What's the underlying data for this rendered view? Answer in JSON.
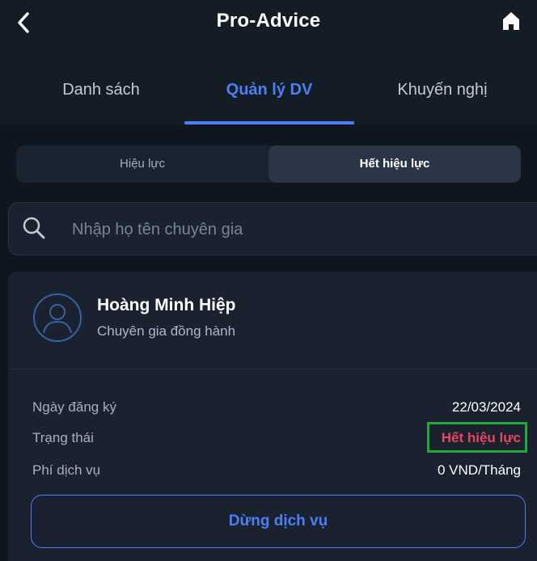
{
  "header": {
    "title": "Pro-Advice",
    "back_icon": "chevron-left-icon",
    "home_icon": "home-icon"
  },
  "tabs": [
    {
      "label": "Danh sách",
      "active": false
    },
    {
      "label": "Quản lý DV",
      "active": true
    },
    {
      "label": "Khuyến nghị",
      "active": false
    }
  ],
  "segments": [
    {
      "label": "Hiệu lực",
      "active": false
    },
    {
      "label": "Hết hiệu lực",
      "active": true
    }
  ],
  "search": {
    "placeholder": "Nhập họ tên chuyên gia",
    "value": "",
    "icon": "search-icon"
  },
  "card": {
    "name": "Hoàng Minh Hiệp",
    "role": "Chuyên gia đồng hành",
    "avatar_icon": "user-avatar-icon",
    "rows": [
      {
        "label": "Ngày đăng ký",
        "value": "22/03/2024"
      },
      {
        "label": "Trạng thái",
        "value": "Hết hiệu lực"
      },
      {
        "label": "Phí dịch vụ",
        "value": "0 VND/Tháng"
      }
    ],
    "action_label": "Dừng dịch vụ"
  },
  "colors": {
    "accent": "#4b7ff4",
    "status_expired": "#e8475c",
    "highlight_box": "#22a83a",
    "background": "#141c26"
  }
}
